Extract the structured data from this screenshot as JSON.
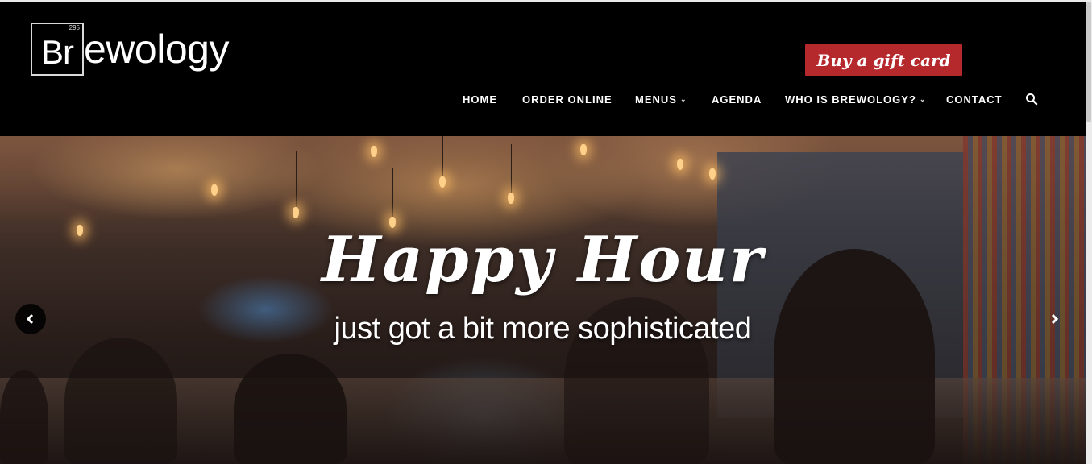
{
  "logo": {
    "number": "295",
    "symbol": "Br",
    "rest": "ewology"
  },
  "gift_button": {
    "label": "Buy a gift card"
  },
  "nav": {
    "items": [
      {
        "label": "HOME",
        "has_dropdown": false
      },
      {
        "label": "ORDER ONLINE",
        "has_dropdown": false
      },
      {
        "label": "MENUS",
        "has_dropdown": true
      },
      {
        "label": "AGENDA",
        "has_dropdown": false
      },
      {
        "label": "WHO IS BREWOLOGY?",
        "has_dropdown": true
      },
      {
        "label": "CONTACT",
        "has_dropdown": false
      }
    ],
    "search_icon": "search-icon"
  },
  "hero": {
    "title": "Happy Hour",
    "subtitle": "just got a bit more sophisticated",
    "prev_icon": "chevron-left-icon",
    "next_icon": "chevron-right-icon"
  },
  "colors": {
    "header_bg": "#000000",
    "gift_bg": "#b5282c",
    "text": "#ffffff"
  }
}
